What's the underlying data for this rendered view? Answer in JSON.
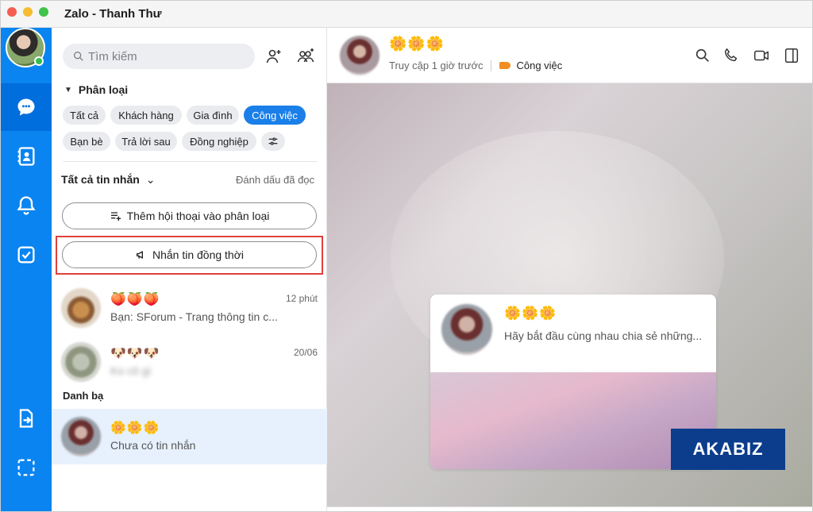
{
  "window": {
    "title": "Zalo - Thanh Thư"
  },
  "search": {
    "placeholder": "Tìm kiếm"
  },
  "categories": {
    "heading": "Phân loại",
    "chips": [
      "Tất cả",
      "Khách hàng",
      "Gia đình",
      "Công việc",
      "Bạn bè",
      "Trả lời sau",
      "Đồng nghiệp"
    ],
    "selected": "Công việc"
  },
  "messages_filter": {
    "label": "Tất cả tin nhắn",
    "mark_read": "Đánh dấu đã đọc"
  },
  "actions": {
    "add_conversation": "Thêm hội thoại vào phân loại",
    "broadcast": "Nhắn tin đồng thời"
  },
  "conversations": [
    {
      "name": "🍑🍑🍑",
      "preview": "Bạn: SForum - Trang thông tin c...",
      "time": "12 phút"
    },
    {
      "name": "🐶🐶🐶",
      "preview": "Ko cô gì",
      "time": "20/06"
    }
  ],
  "contacts": {
    "title": "Danh bạ",
    "items": [
      {
        "name": "🌼🌼🌼",
        "preview": "Chưa có tin nhắn"
      }
    ]
  },
  "chat": {
    "name": "🌼🌼🌼",
    "status": "Truy cập 1 giờ trước",
    "tag": "Công việc",
    "card_name": "🌼🌼🌼",
    "card_text": "Hãy bắt đầu cùng nhau chia sẻ những..."
  },
  "watermark": "AKABIZ",
  "colors": {
    "rail": "#0a84f0",
    "accent": "#1a7fe8",
    "highlight_border": "#e0413a",
    "tag": "#f08d23"
  }
}
